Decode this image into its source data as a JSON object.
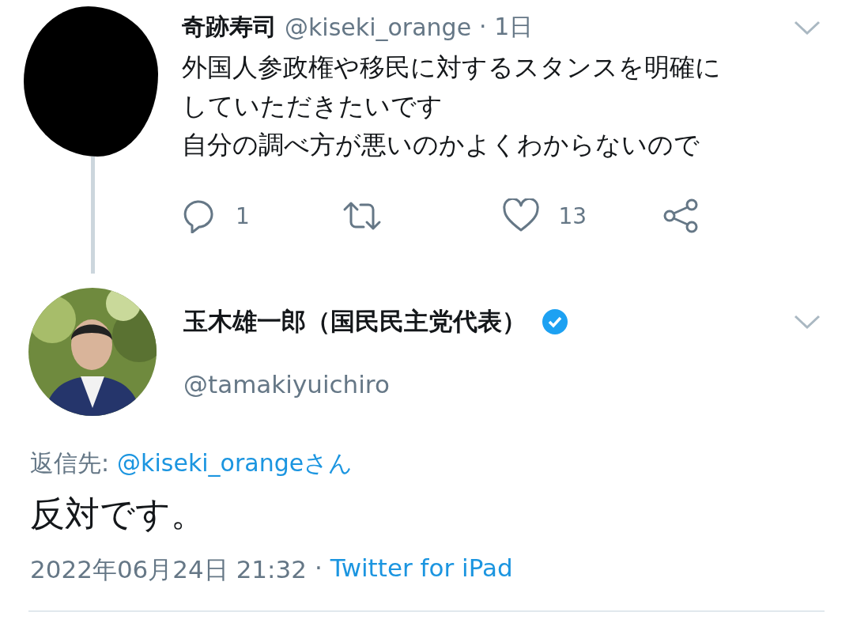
{
  "parent_tweet": {
    "author": {
      "name": "奇跡寿司",
      "handle": "@kiseki_orange",
      "time": "· 1日"
    },
    "paragraphs": [
      "外国人参政権や移民に対するスタンスを明確にしていただきたいです",
      "自分の調べ方が悪いのかよくわからないので"
    ],
    "actions": [
      {
        "kind": "reply",
        "count": "1"
      },
      {
        "kind": "retweet"
      },
      {
        "kind": "like",
        "count": "13"
      },
      {
        "kind": "share"
      }
    ]
  },
  "main_tweet": {
    "name": "玉木雄一郎（国民民主党代表）",
    "verified": true,
    "handle": "@tamakiyuichiro",
    "reply_to_label": "返信先:",
    "reply_to": "@kiseki_orangeさん",
    "text": "反対です。",
    "timestamp": "2022年06月24日 21:32",
    "separator": "·",
    "source": "Twitter for iPad"
  }
}
